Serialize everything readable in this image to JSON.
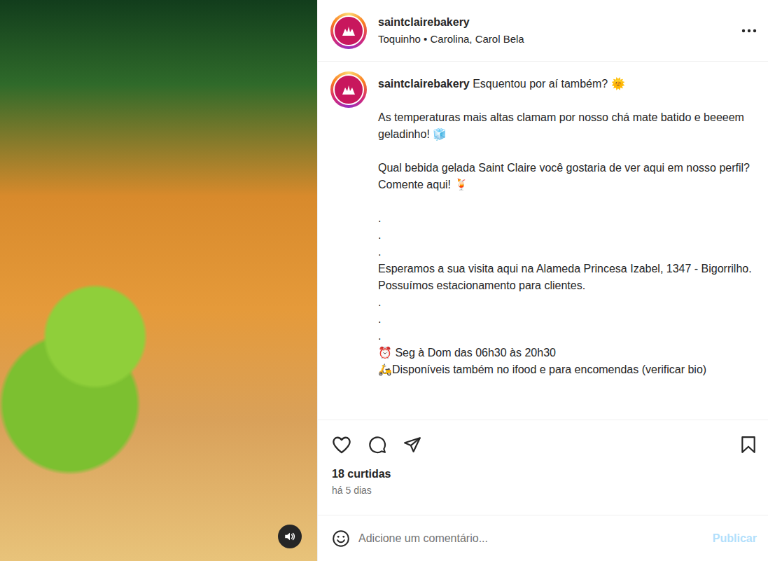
{
  "post": {
    "media": {
      "kind": "video",
      "sound_on": true
    },
    "account": {
      "username": "saintclairebakery",
      "subtitle": "Toquinho • Carolina, Carol Bela"
    },
    "caption": {
      "username": "saintclairebakery",
      "lines": [
        "Esquentou por aí também? 🌞",
        "",
        "As temperaturas mais altas clamam por nosso chá mate batido e beeeem geladinho! 🧊",
        "",
        "Qual bebida gelada Saint Claire você gostaria de ver aqui em nosso perfil? Comente aqui! 🍹",
        "",
        ".",
        ".",
        ".",
        "Esperamos a sua visita aqui na Alameda Princesa Izabel, 1347 - Bigorrilho.",
        "Possuímos estacionamento para clientes.",
        ".",
        ".",
        ".",
        "⏰ Seg à Dom das 06h30 às 20h30",
        "🛵Disponíveis também no ifood e para encomendas (verificar bio)"
      ]
    },
    "liked": false,
    "saved": false,
    "likes": "18 curtidas",
    "time": "há 5 dias",
    "comment_box": {
      "placeholder": "Adicione um comentário...",
      "button": "Publicar",
      "button_disabled": true
    }
  }
}
